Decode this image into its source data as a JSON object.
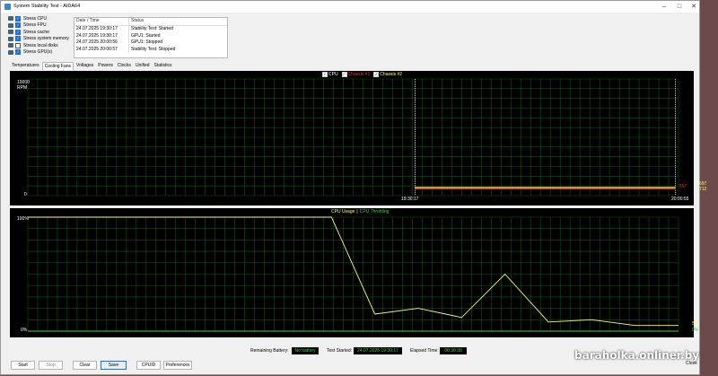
{
  "window": {
    "title": "System Stability Test - AIDA64",
    "minimize": "–",
    "maximize": "□",
    "close": "✕"
  },
  "stress_options": [
    {
      "label": "Stress CPU",
      "checked": true
    },
    {
      "label": "Stress FPU",
      "checked": true
    },
    {
      "label": "Stress cache",
      "checked": true
    },
    {
      "label": "Stress system memory",
      "checked": true
    },
    {
      "label": "Stress local disks",
      "checked": false
    },
    {
      "label": "Stress GPU(s)",
      "checked": true
    }
  ],
  "log": {
    "headers": [
      "Date / Time",
      "Status"
    ],
    "rows": [
      [
        "24.07.2025 19:30:17",
        "Stability Test: Started"
      ],
      [
        "24.07.2025 19:30:17",
        "GPU1: Started"
      ],
      [
        "24.07.2025 20:00:56",
        "GPU1: Stopped"
      ],
      [
        "24.07.2025 20:00:57",
        "Stability Test: Stopped"
      ]
    ]
  },
  "tabs": [
    "Temperatures",
    "Cooling Fans",
    "Voltages",
    "Powers",
    "Clocks",
    "Unified",
    "Statistics"
  ],
  "active_tab": "Cooling Fans",
  "fan_chart": {
    "legend": [
      {
        "label": "CPU",
        "color": "#ffffff"
      },
      {
        "label": "Chassis #1",
        "color": "#ff3030"
      },
      {
        "label": "Chassis #2",
        "color": "#ffff60"
      }
    ],
    "y_top": "10000",
    "y_unit": "RPM",
    "y_bottom": "0",
    "x_start": "19:30:17",
    "x_end": "20:00:55",
    "right_values": [
      {
        "text": "597",
        "color": "#ff3030"
      },
      {
        "text": "697",
        "color": "#ffff60"
      },
      {
        "text": "712",
        "color": "#ffff60"
      }
    ]
  },
  "usage_chart": {
    "legend_a": "CPU Usage",
    "legend_sep": "|",
    "legend_b": "CPU Throttling",
    "y_top": "100%",
    "y_bottom": "0%",
    "right_a": "5%",
    "right_b": "0%"
  },
  "chart_data": [
    {
      "type": "line",
      "ylabel": "RPM",
      "ylim": [
        0,
        10000
      ],
      "x": [
        "19:30:17",
        "20:00:55"
      ],
      "series": [
        {
          "name": "CPU",
          "values": []
        },
        {
          "name": "Chassis #1",
          "values": [
            597,
            597
          ]
        },
        {
          "name": "Chassis #2",
          "values": [
            697,
            697
          ]
        }
      ]
    },
    {
      "type": "line",
      "ylim": [
        0,
        100
      ],
      "series": [
        {
          "name": "CPU Usage",
          "values": [
            100,
            100,
            100,
            100,
            100,
            100,
            100,
            100,
            15,
            20,
            12,
            50,
            8,
            10,
            5,
            5
          ]
        },
        {
          "name": "CPU Throttling",
          "values": [
            0,
            0,
            0,
            0,
            0,
            0,
            0,
            0,
            0,
            0,
            0,
            0,
            0,
            0,
            0,
            0
          ]
        }
      ]
    }
  ],
  "status": {
    "battery_label": "Remaining Battery:",
    "battery_value": "No battery",
    "started_label": "Test Started:",
    "started_value": "24.07.2025 19:30:17",
    "elapsed_label": "Elapsed Time:",
    "elapsed_value": "00:30:38"
  },
  "buttons": {
    "start": "Start",
    "stop": "Stop",
    "clear": "Clear",
    "save": "Save",
    "cpuid": "CPUID",
    "preferences": "Preferences",
    "close": "Close"
  },
  "watermark": "baraholka.onliner.by"
}
